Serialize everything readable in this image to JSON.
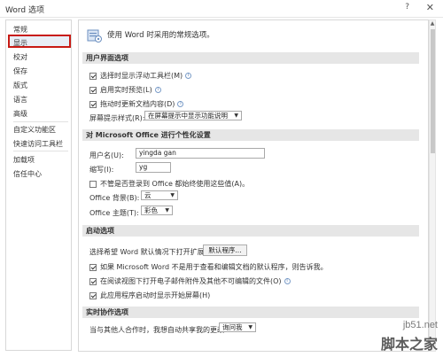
{
  "window": {
    "title": "Word 选项",
    "help": "?",
    "close": "✕"
  },
  "sidebar": {
    "items": [
      "常规",
      "显示",
      "校对",
      "保存",
      "版式",
      "语言",
      "高级",
      "自定义功能区",
      "快速访问工具栏",
      "加载项",
      "信任中心"
    ],
    "highlighted": "显示"
  },
  "main": {
    "intro": "使用 Word 时采用的常规选项。",
    "sections": {
      "ui": "用户界面选项",
      "personalize": "对 Microsoft Office 进行个性化设置",
      "startup": "启动选项",
      "realtime": "实时协作选项"
    },
    "ui_options": {
      "mini_toolbar": "选择时显示浮动工具栏(M)",
      "live_preview": "启用实时预览(L)",
      "update_content": "拖动时更新文档内容(D)",
      "screentip_label": "屏幕提示样式(R):",
      "screentip_value": "在屏幕提示中显示功能说明"
    },
    "personalize": {
      "username_label": "用户名(U):",
      "username_value": "yingda gan",
      "initials_label": "缩写(I):",
      "initials_value": "yg",
      "always_use": "不管是否登录到 Office 都始终使用这些值(A)。",
      "background_label": "Office 背景(B):",
      "background_value": "云",
      "theme_label": "Office 主题(T):",
      "theme_value": "彩色"
    },
    "startup": {
      "ext_label": "选择希望 Word 默认情况下打开扩展名:",
      "default_programs": "默认程序...",
      "not_default": "如果 Microsoft Word 不是用于查看和编辑文档的默认程序，则告诉我。",
      "open_attachments": "在阅读视图下打开电子邮件附件及其他不可编辑的文件(O)",
      "show_start": "此应用程序启动时显示开始屏幕(H)"
    },
    "realtime": {
      "share_label": "当与其他人合作时，我想自动共享我的更改:",
      "share_value": "询问我"
    }
  },
  "watermark": {
    "line1": "jb51.net",
    "line2": "脚本之家"
  }
}
